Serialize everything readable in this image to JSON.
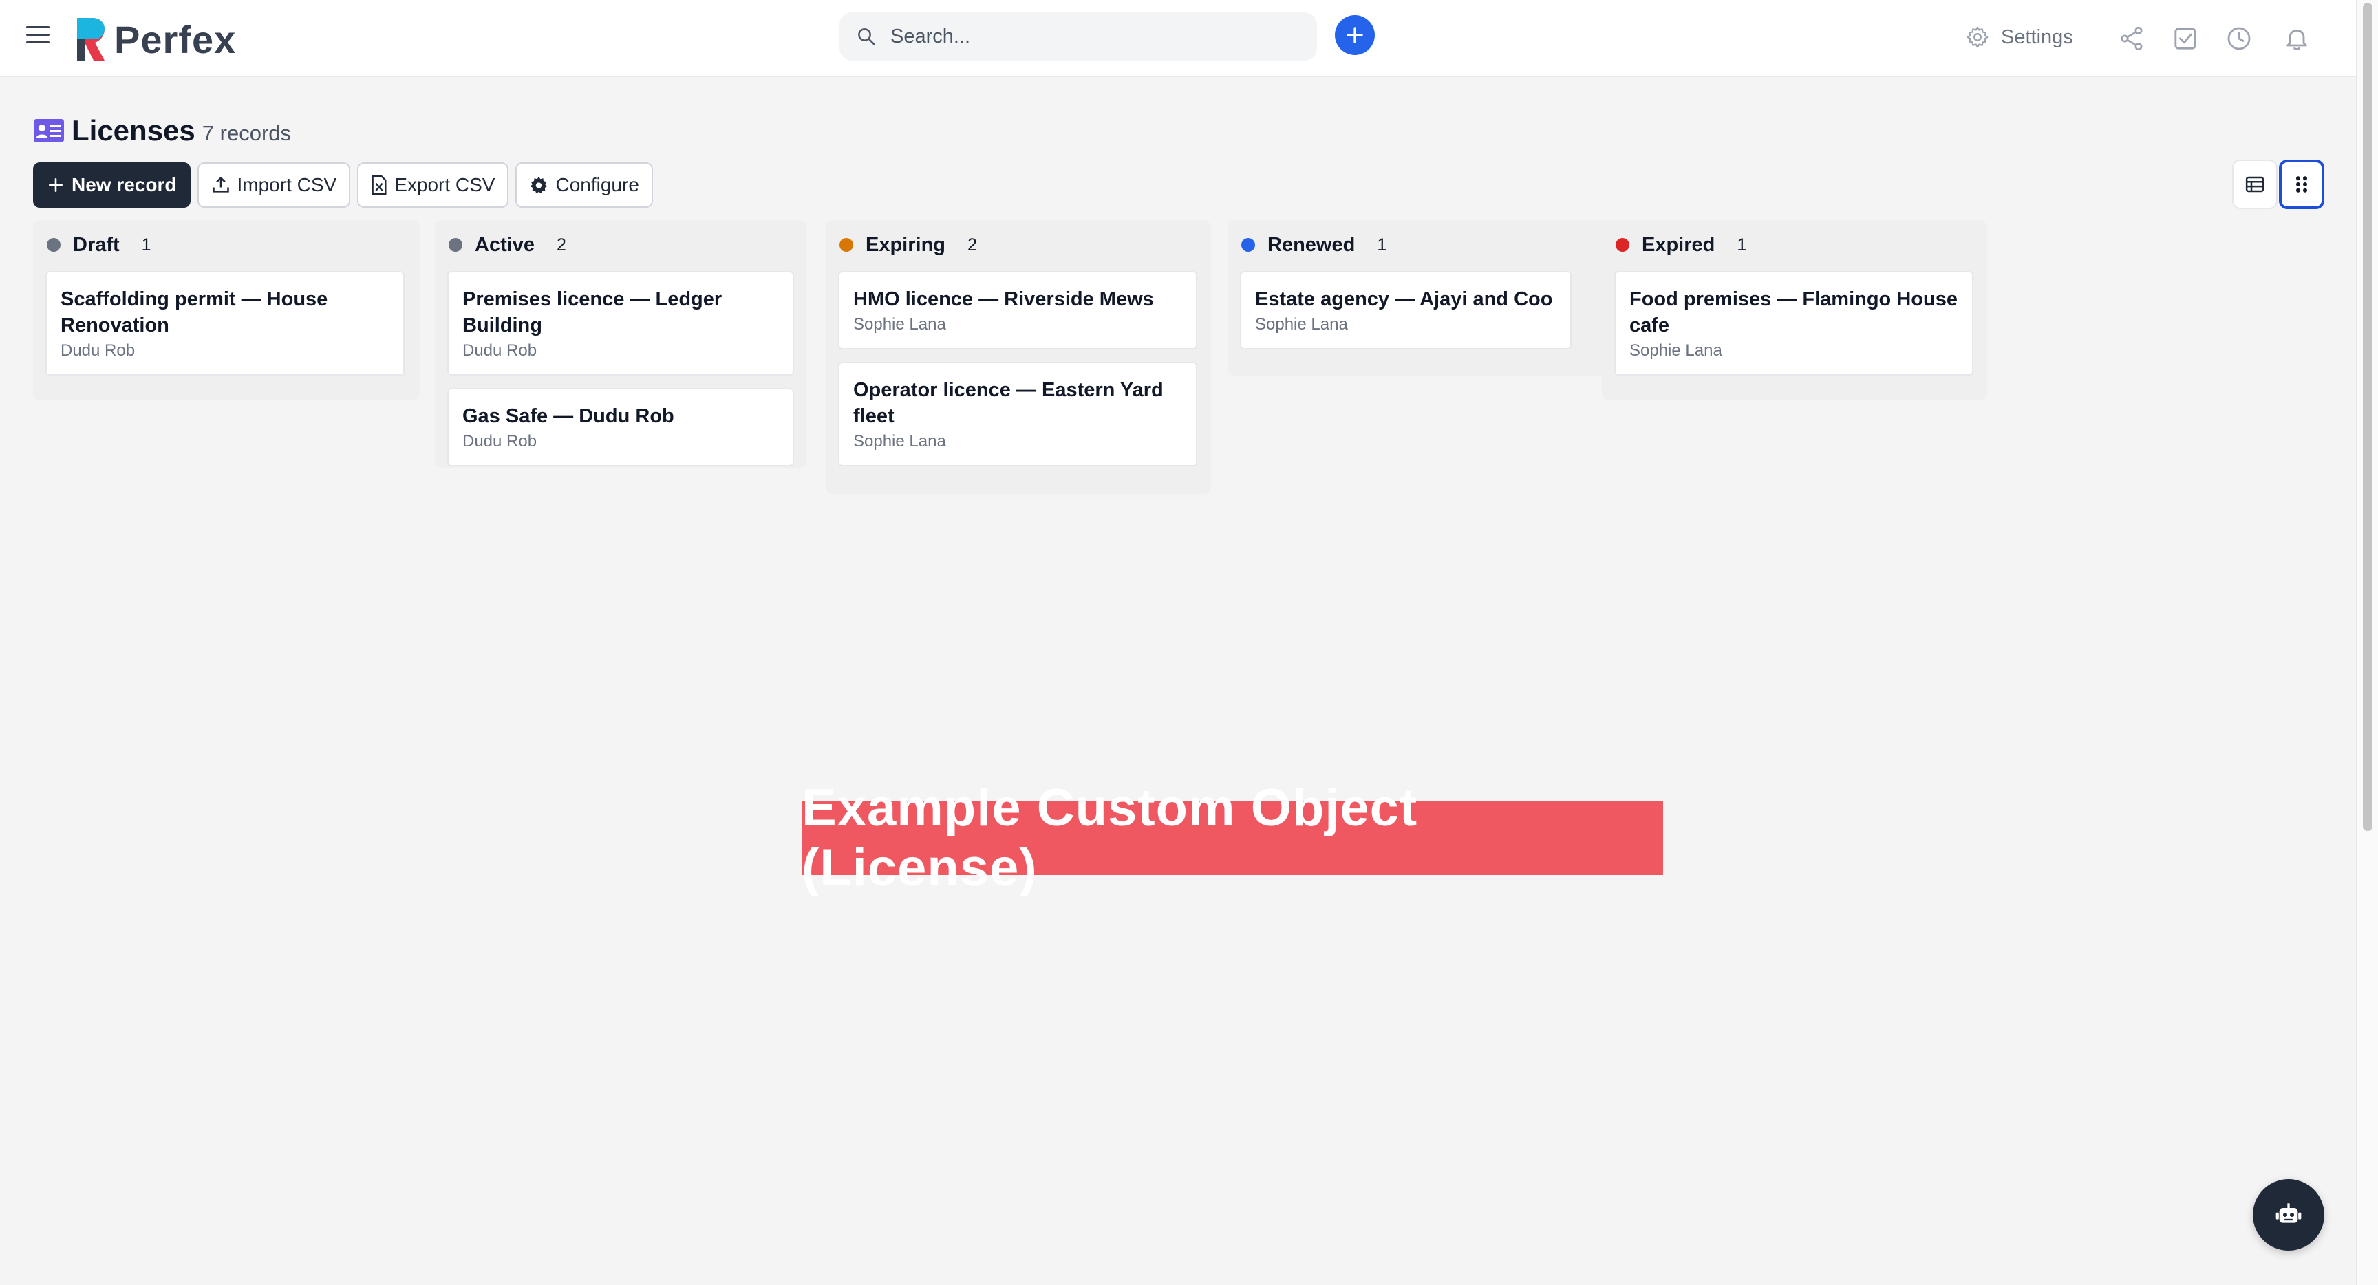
{
  "header": {
    "app_name": "Perfex",
    "search_placeholder": "Search...",
    "settings_label": "Settings"
  },
  "page": {
    "title": "Licenses",
    "record_count": "7 records"
  },
  "toolbar": {
    "new_record": "New record",
    "import_csv": "Import CSV",
    "export_csv": "Export CSV",
    "configure": "Configure"
  },
  "columns": [
    {
      "name": "Draft",
      "count": "1",
      "color": "#6b7280",
      "cards": [
        {
          "title": "Scaffolding permit — House Renovation",
          "owner": "Dudu Rob"
        }
      ]
    },
    {
      "name": "Active",
      "count": "2",
      "color": "#6b7280",
      "cards": [
        {
          "title": "Premises licence — Ledger Building",
          "owner": "Dudu Rob"
        },
        {
          "title": "Gas Safe — Dudu Rob",
          "owner": "Dudu Rob"
        }
      ]
    },
    {
      "name": "Expiring",
      "count": "2",
      "color": "#d97706",
      "cards": [
        {
          "title": "HMO licence — Riverside Mews",
          "owner": "Sophie Lana"
        },
        {
          "title": "Operator licence — Eastern Yard fleet",
          "owner": "Sophie Lana"
        }
      ]
    },
    {
      "name": "Renewed",
      "count": "1",
      "color": "#2563eb",
      "cards": [
        {
          "title": "Estate agency — Ajayi and Coo",
          "owner": "Sophie Lana"
        }
      ]
    },
    {
      "name": "Expired",
      "count": "1",
      "color": "#dc2626",
      "cards": [
        {
          "title": "Food premises — Flamingo House cafe",
          "owner": "Sophie Lana"
        }
      ]
    }
  ],
  "banner": "Example Custom Object (License)",
  "colors": {
    "accent": "#2563eb",
    "primary_button": "#1f2937",
    "banner": "#ef5861",
    "logo_blue": "#1cb5e0",
    "logo_red": "#e5384a"
  }
}
